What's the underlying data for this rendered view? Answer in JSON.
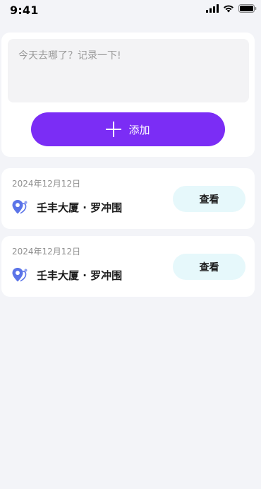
{
  "status_bar": {
    "time": "9:41",
    "icons": [
      "signal-icon",
      "wifi-icon",
      "battery-icon"
    ]
  },
  "input_card": {
    "placeholder": "今天去哪了？记录一下!",
    "add_label": "添加"
  },
  "records": [
    {
      "date": "2024年12月12日",
      "location": "壬丰大厦 · 罗冲围",
      "view_label": "查看"
    },
    {
      "date": "2024年12月12日",
      "location": "壬丰大厦 · 罗冲围",
      "view_label": "查看"
    }
  ],
  "colors": {
    "background": "#f3f4f8",
    "accent": "#7b2df5",
    "view_button_bg": "#e6f8fb",
    "pin_icon": "#5b74e8"
  }
}
